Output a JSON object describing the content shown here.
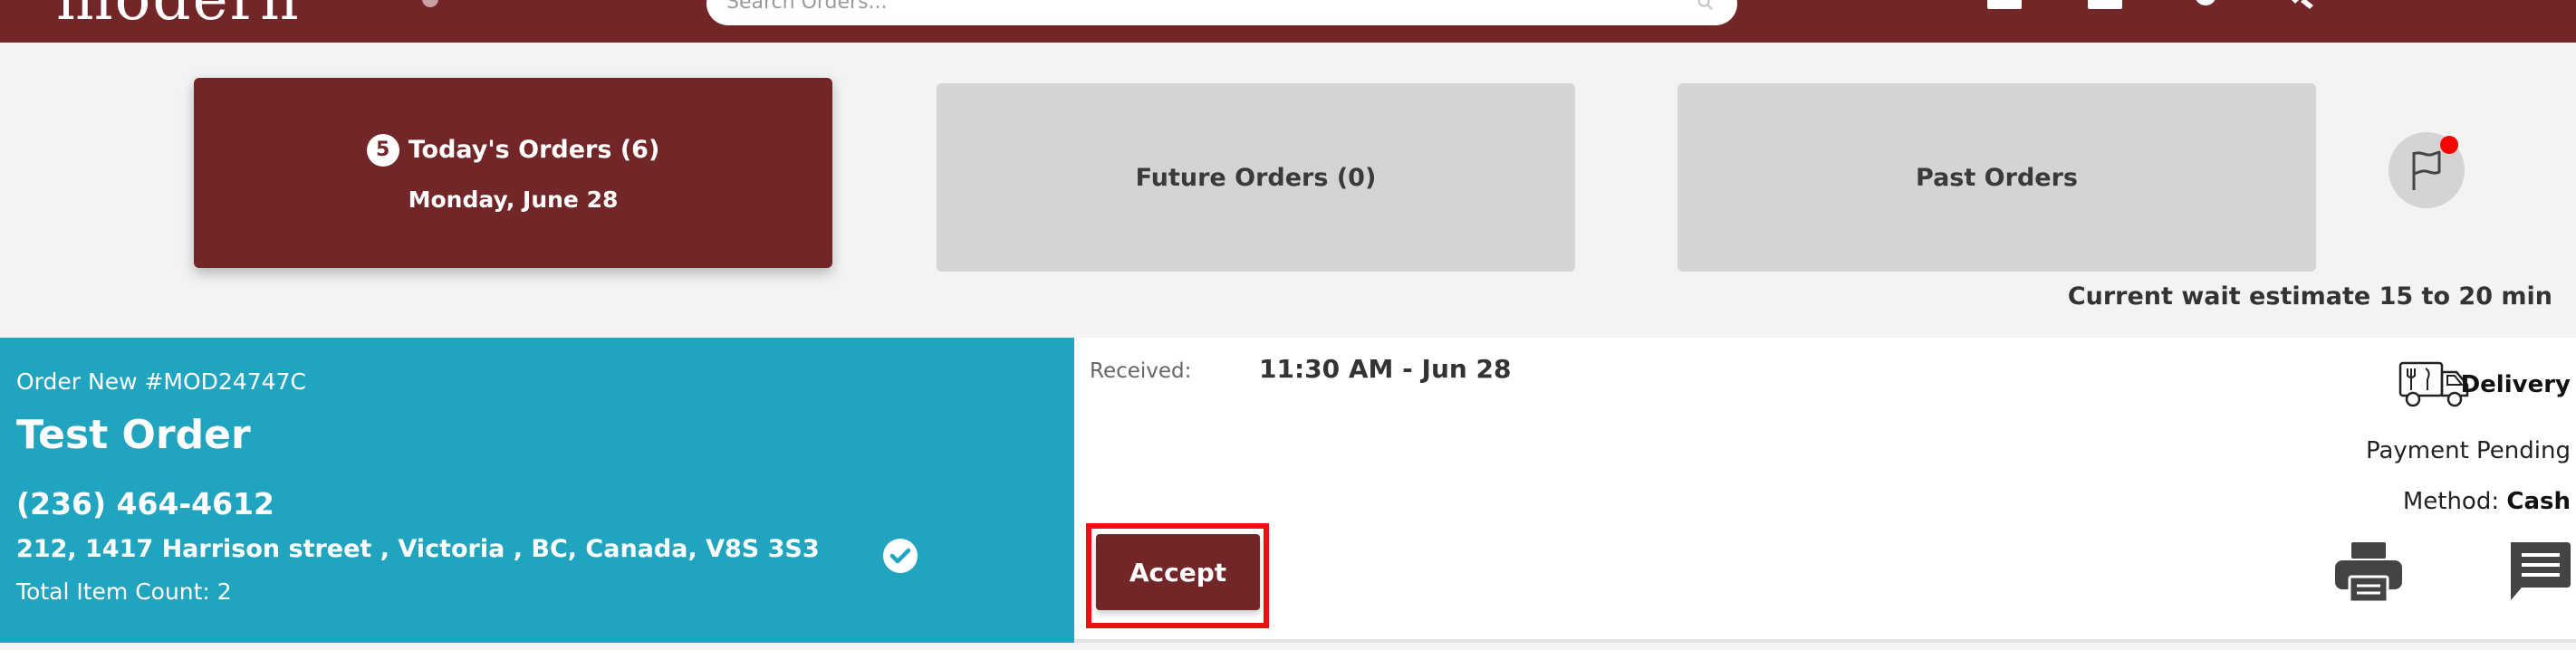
{
  "header": {
    "logo_text": "modern",
    "search": {
      "placeholder": "Search Orders..."
    },
    "icons": [
      "notebook-icon",
      "monitor-icon",
      "gear-icon",
      "tools-icon",
      "account-icon"
    ]
  },
  "tabs": [
    {
      "label": "Today's Orders (6)",
      "badge": "5",
      "subtitle": "Monday, June 28",
      "active": true
    },
    {
      "label": "Future Orders (0)",
      "active": false
    },
    {
      "label": "Past Orders",
      "active": false
    }
  ],
  "wait_estimate": "Current wait estimate 15 to 20 min",
  "order": {
    "label": "Order New #MOD24747C",
    "name": "Test Order",
    "phone": "(236) 464-4612",
    "address": "212, 1417 Harrison street , Victoria , BC, Canada, V8S 3S3",
    "item_count": "Total Item Count: 2",
    "received_label": "Received:",
    "received_value": "11:30 AM - Jun 28",
    "delivery_label": "Delivery",
    "payment_status": "Payment Pending",
    "method_label": "Method:",
    "method_value": "Cash",
    "accept_label": "Accept"
  },
  "colors": {
    "brand": "#722628",
    "order_panel": "#21a4bf",
    "inactive_tab": "#d4d4d4",
    "highlight": "#ee0f12",
    "notification_dot": "#ff0000"
  }
}
